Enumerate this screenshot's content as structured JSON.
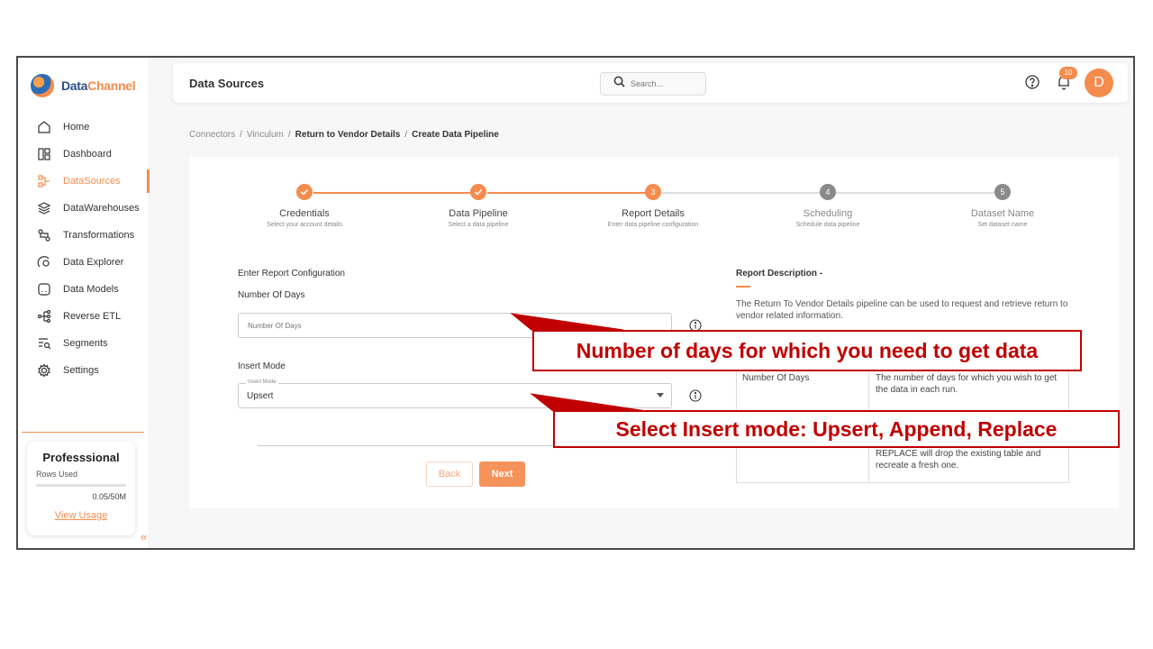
{
  "brand": {
    "name_part1": "Data",
    "name_part2": "Channel"
  },
  "sidebar": {
    "items": [
      {
        "label": "Home",
        "icon": "home-icon"
      },
      {
        "label": "Dashboard",
        "icon": "dashboard-icon"
      },
      {
        "label": "DataSources",
        "icon": "datasources-icon",
        "active": true
      },
      {
        "label": "DataWarehouses",
        "icon": "layers-icon"
      },
      {
        "label": "Transformations",
        "icon": "transform-icon"
      },
      {
        "label": "Data Explorer",
        "icon": "explorer-icon"
      },
      {
        "label": "Data Models",
        "icon": "models-icon"
      },
      {
        "label": "Reverse ETL",
        "icon": "reverse-etl-icon"
      },
      {
        "label": "Segments",
        "icon": "segments-icon"
      },
      {
        "label": "Settings",
        "icon": "gear-icon"
      }
    ],
    "plan": {
      "title": "Professsional",
      "rows_label": "Rows Used",
      "rows_count": "0.05/50M",
      "rows_used_fraction": 0.001,
      "link": "View Usage"
    }
  },
  "header": {
    "title": "Data Sources",
    "search_placeholder": "Search...",
    "notifications": "10",
    "avatar": "D"
  },
  "breadcrumb": [
    "Connectors",
    "Vinculum",
    "Return to Vendor Details",
    "Create Data Pipeline"
  ],
  "stepper": [
    {
      "label": "Credentials",
      "sub": "Select your account details",
      "state": "done"
    },
    {
      "label": "Data Pipeline",
      "sub": "Select a data pipeline",
      "state": "done"
    },
    {
      "label": "Report Details",
      "sub": "Enter data pipeline configuration",
      "state": "current",
      "num": "3"
    },
    {
      "label": "Scheduling",
      "sub": "Schedule data pipeline",
      "state": "pending",
      "num": "4"
    },
    {
      "label": "Dataset Name",
      "sub": "Set dataset name",
      "state": "pending",
      "num": "5"
    }
  ],
  "form": {
    "section_title": "Enter Report Configuration",
    "days_label": "Number Of Days",
    "days_placeholder": "Number Of Days",
    "insert_label": "Insert Mode",
    "insert_legend": "Insert Mode",
    "insert_value": "Upsert",
    "back_label": "Back",
    "next_label": "Next"
  },
  "description": {
    "title": "Report Description -",
    "text": "The Return To Vendor Details pipeline can be used to request and retrieve return to vendor related information.",
    "row1_key": "Number Of Days",
    "row1_value": "The number of days for which you wish to get the data in each run.",
    "row2_value": "REPLACE will drop the existing table and recreate a fresh one."
  },
  "annotations": {
    "days": "Number of days for which you need to get data",
    "insert": "Select Insert mode: Upsert, Append, Replace"
  },
  "colors": {
    "accent": "#f58b4c",
    "callout": "#c00000",
    "pending": "#8a8a8a"
  }
}
